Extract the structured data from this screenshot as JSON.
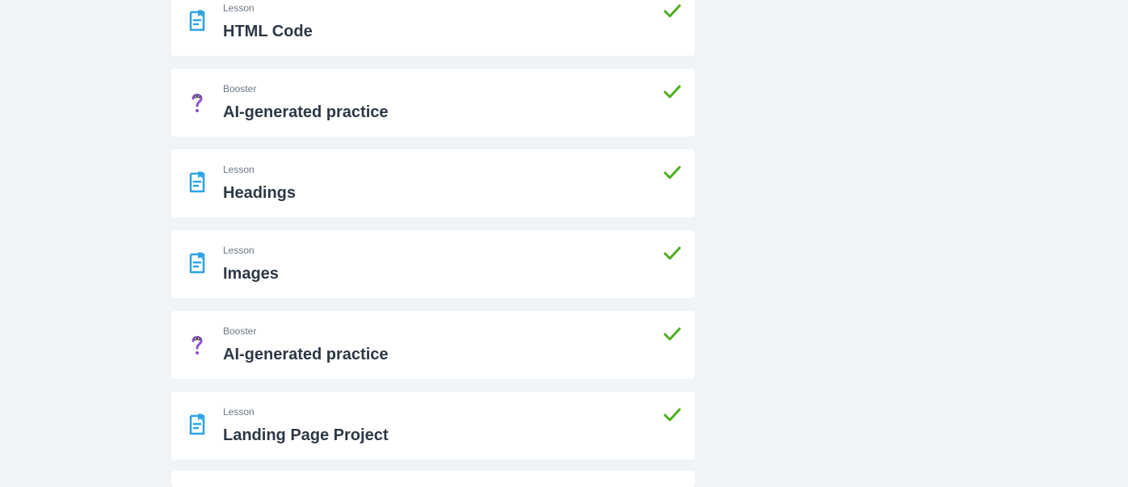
{
  "items": [
    {
      "kind": "Lesson",
      "title": "HTML Code",
      "type": "lesson",
      "completed": true
    },
    {
      "kind": "Booster",
      "title": "AI-generated practice",
      "type": "booster",
      "completed": true
    },
    {
      "kind": "Lesson",
      "title": "Headings",
      "type": "lesson",
      "completed": true
    },
    {
      "kind": "Lesson",
      "title": "Images",
      "type": "lesson",
      "completed": true
    },
    {
      "kind": "Booster",
      "title": "AI-generated practice",
      "type": "booster",
      "completed": true
    },
    {
      "kind": "Lesson",
      "title": "Landing Page Project",
      "type": "lesson",
      "completed": true
    }
  ],
  "colors": {
    "background": "#f0f4f7",
    "card": "#ffffff",
    "lesson_icon": "#2ba3e6",
    "booster_icon": "#8d4fd6",
    "check": "#4caf1e",
    "title": "#2d3846",
    "kind": "#6b7785"
  },
  "icons": {
    "lesson": "lesson-document-icon",
    "booster": "question-mark-icon",
    "completed": "checkmark-icon"
  }
}
